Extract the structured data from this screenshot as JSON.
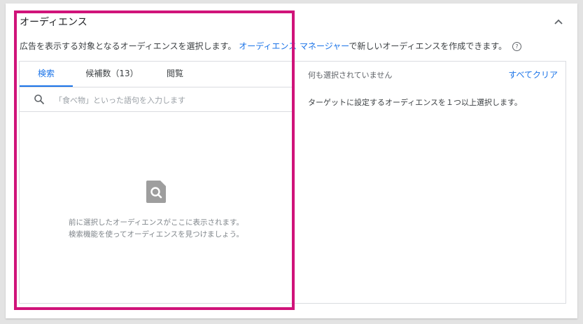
{
  "section": {
    "title": "オーディエンス",
    "description_prefix": "広告を表示する対象となるオーディエンスを選択します。",
    "manager_link": "オーディエンス マネージャー",
    "description_suffix": "で新しいオーディエンスを作成できます。",
    "help_glyph": "?"
  },
  "tabs": [
    {
      "label": "検索",
      "active": true
    },
    {
      "label": "候補数（13）",
      "active": false
    },
    {
      "label": "閲覧",
      "active": false
    }
  ],
  "search": {
    "placeholder": "「食べ物」といった語句を入力します",
    "value": ""
  },
  "empty_state": {
    "line1": "前に選択したオーディエンスがここに表示されます。",
    "line2": "検索機能を使ってオーディエンスを見つけましょう。"
  },
  "selection": {
    "status": "何も選択されていません",
    "clear_all": "すべてクリア",
    "hint": "ターゲットに設定するオーディエンスを１つ以上選択します。"
  },
  "colors": {
    "accent": "#1a73e8",
    "highlight_border": "#d0137a"
  }
}
